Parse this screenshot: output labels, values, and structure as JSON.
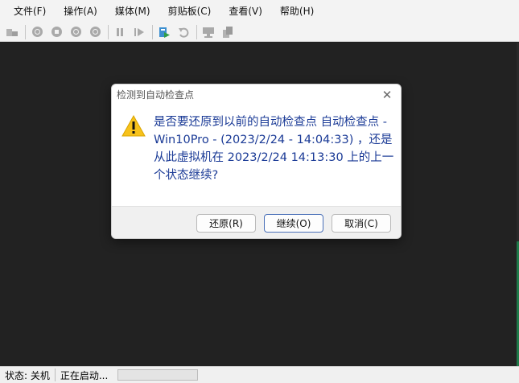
{
  "menu": {
    "items": [
      {
        "label": "文件(F)"
      },
      {
        "label": "操作(A)"
      },
      {
        "label": "媒体(M)"
      },
      {
        "label": "剪贴板(C)"
      },
      {
        "label": "查看(V)"
      },
      {
        "label": "帮助(H)"
      }
    ]
  },
  "toolbar": {
    "icons": [
      "settings-icon",
      "start-icon",
      "turn-off-icon",
      "shutdown-icon",
      "save-icon",
      "pause-icon",
      "reset-icon",
      "checkpoint-icon",
      "revert-icon",
      "enhanced-session-icon",
      "share-icon"
    ]
  },
  "dialog": {
    "title": "检测到自动检查点",
    "close_glyph": "✕",
    "message": "是否要还原到以前的自动检查点 自动检查点 - Win10Pro - (2023/2/24 - 14:04:33) ，还是从此虚拟机在 2023/2/24 14:13:30 上的上一个状态继续?",
    "buttons": {
      "revert": "还原(R)",
      "continue": "继续(O)",
      "cancel": "取消(C)"
    },
    "icon": "warning-icon"
  },
  "status": {
    "state": "状态: 关机",
    "activity": "正在启动..."
  },
  "colors": {
    "message_text": "#1a3a96",
    "warning_fill": "#f7c21b",
    "vm_background": "#222222"
  }
}
